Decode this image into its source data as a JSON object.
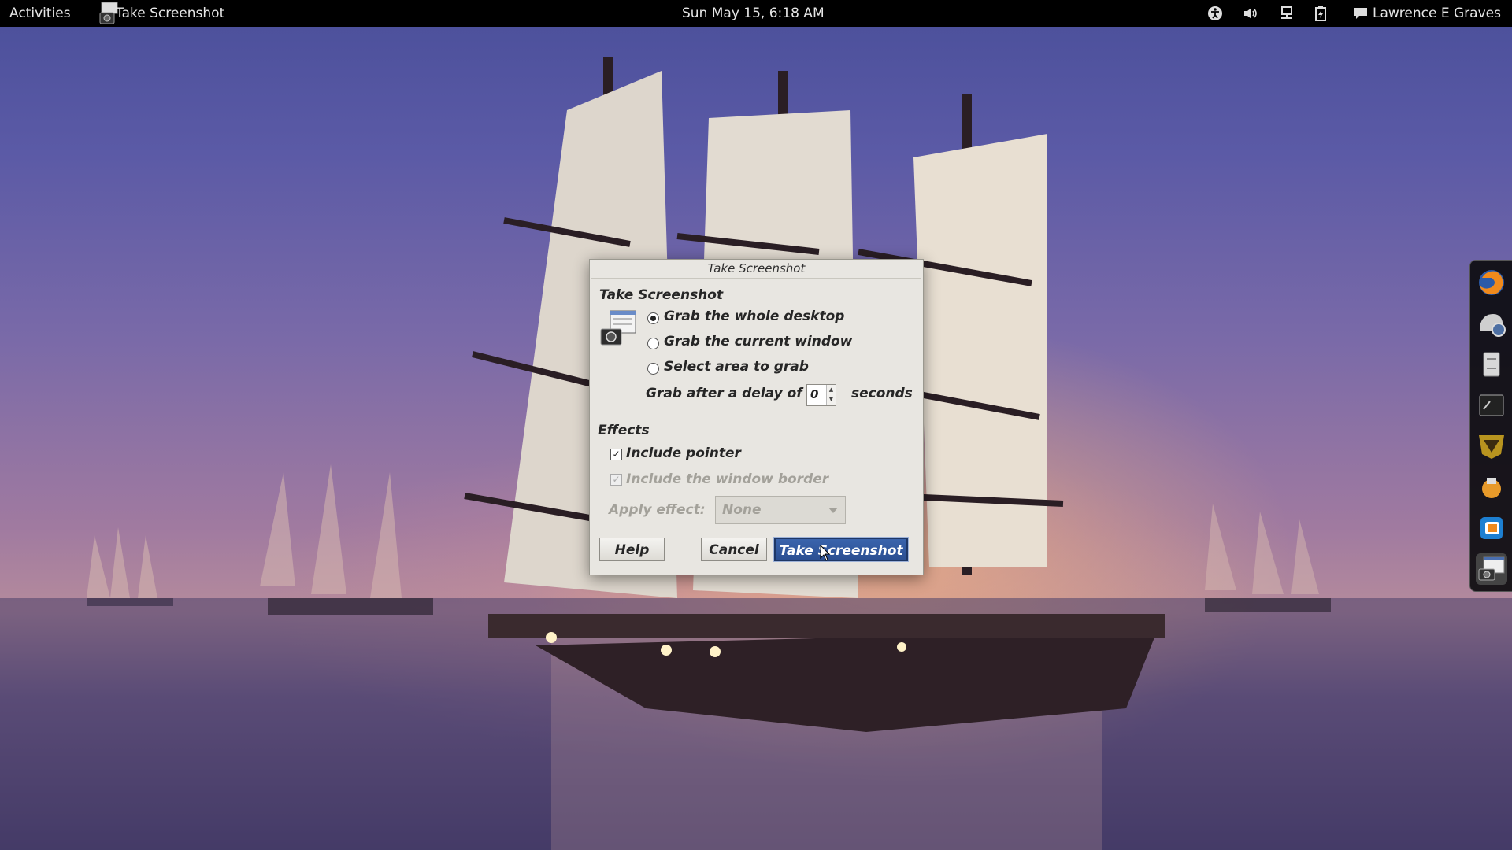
{
  "top_panel": {
    "activities": "Activities",
    "app_name": "Take Screenshot",
    "clock": "Sun May 15,  6:18 AM",
    "user": "Lawrence E Graves",
    "status_icons": [
      "accessibility-icon",
      "volume-icon",
      "network-icon",
      "battery-icon",
      "chat-icon"
    ]
  },
  "dock": {
    "items": [
      "firefox-icon",
      "time-machine-icon",
      "file-cabinet-icon",
      "terminal-icon",
      "wesnoth-icon",
      "software-icon",
      "virtualbox-icon",
      "screenshot-app-icon"
    ]
  },
  "dialog": {
    "title": "Take Screenshot",
    "section_title": "Take Screenshot",
    "options": [
      {
        "label": "Grab the whole desktop",
        "selected": true
      },
      {
        "label": "Grab the current window",
        "selected": false
      },
      {
        "label": "Select area to grab",
        "selected": false
      }
    ],
    "delay": {
      "prefix": "Grab after a delay of",
      "value": "0",
      "suffix": "seconds"
    },
    "effects_title": "Effects",
    "include_pointer": {
      "label": "Include pointer",
      "checked": true
    },
    "include_border": {
      "label": "Include the window border",
      "checked": true,
      "enabled": false
    },
    "apply_effect": {
      "label": "Apply effect:",
      "value": "None",
      "enabled": false
    },
    "buttons": {
      "help": "Help",
      "cancel": "Cancel",
      "take": "Take Screenshot"
    }
  },
  "colors": {
    "panel_bg": "#000000",
    "dialog_bg": "#e8e6e1",
    "default_button": "#2b4f92"
  }
}
